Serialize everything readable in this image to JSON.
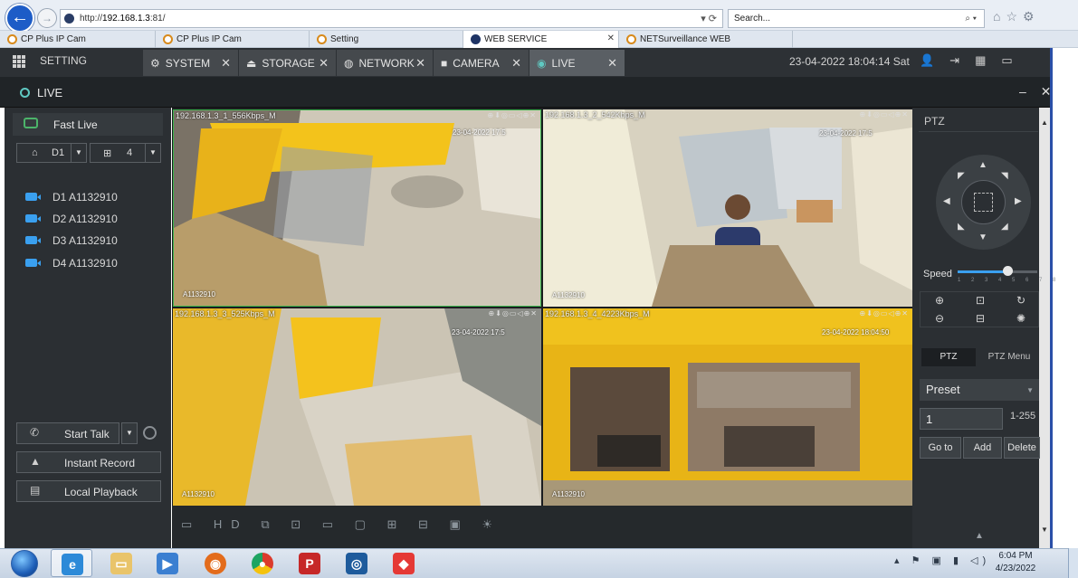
{
  "browser": {
    "url_prefix": "http://",
    "url_host": "192.168.1.3",
    "url_suffix": ":81/",
    "address_controls": "▾ ⟳",
    "search_placeholder": "Search...",
    "search_controls": "⌕ ▾",
    "tabs": [
      {
        "label": "CP Plus IP Cam",
        "active": false
      },
      {
        "label": "CP Plus IP Cam",
        "active": false
      },
      {
        "label": "Setting",
        "active": false
      },
      {
        "label": "WEB SERVICE",
        "active": true
      },
      {
        "label": "NETSurveillance WEB",
        "active": false
      }
    ]
  },
  "appbar": {
    "setting_label": "SETTING",
    "tabs": [
      {
        "label": "SYSTEM",
        "icon": "gear-icon"
      },
      {
        "label": "STORAGE",
        "icon": "storage-icon"
      },
      {
        "label": "NETWORK",
        "icon": "network-icon"
      },
      {
        "label": "CAMERA",
        "icon": "camera-icon"
      },
      {
        "label": "LIVE",
        "icon": "live-icon"
      }
    ],
    "datetime": "23-04-2022 18:04:14 Sat"
  },
  "live": {
    "title": "LIVE",
    "window_controls": "– ✕"
  },
  "sidebar": {
    "fast_live": "Fast Live",
    "channel_select": "D1",
    "layout_select": "4",
    "cameras": [
      {
        "label": "D1 A1132910"
      },
      {
        "label": "D2 A1132910"
      },
      {
        "label": "D3 A1132910"
      },
      {
        "label": "D4 A1132910"
      }
    ],
    "buttons": {
      "start_talk": "Start Talk",
      "instant_record": "Instant Record",
      "local_playback": "Local Playback"
    }
  },
  "video": {
    "tiles": [
      {
        "label": "192.168.1.3_1_556Kbps_M",
        "stamp": "23-04-2022 17:5",
        "cam": "A1132910"
      },
      {
        "label": "192.168.1.3_2_542Kbps_M",
        "stamp": "23-04-2022 17:5",
        "cam": "A1132910"
      },
      {
        "label": "192.168.1.3_3_525Kbps_M",
        "stamp": "23-04-2022 17:5",
        "cam": "A1132910"
      },
      {
        "label": "192.168.1.3_4_4223Kbps_M",
        "stamp": "23-04-2022 18:04:50",
        "cam": "A1132910"
      }
    ],
    "tile_icons": "⊕⬇◎▭◁⊕✕",
    "toolbar_hd": "HD",
    "toolbar_icons": "⧉ ⊡ ▭ ▢ ⊞ ⊟ ▣ ☀"
  },
  "ptz": {
    "title": "PTZ",
    "speed_label": "Speed",
    "speed_value": 0.62,
    "speed_ticks": "1 2 3 4 5 6 7 8",
    "tab_ptz": "PTZ",
    "tab_menu": "PTZ Menu",
    "preset_select": "Preset",
    "preset_value": "1",
    "preset_range": "1-255",
    "goto_label": "Go to",
    "add_label": "Add",
    "delete_label": "Delete"
  },
  "taskbar": {
    "time": "6:04 PM",
    "date": "4/23/2022"
  },
  "colors": {
    "accent": "#5fc9c2",
    "camera_icon": "#3aa0f0",
    "active_tile_border": "#38b24a"
  }
}
